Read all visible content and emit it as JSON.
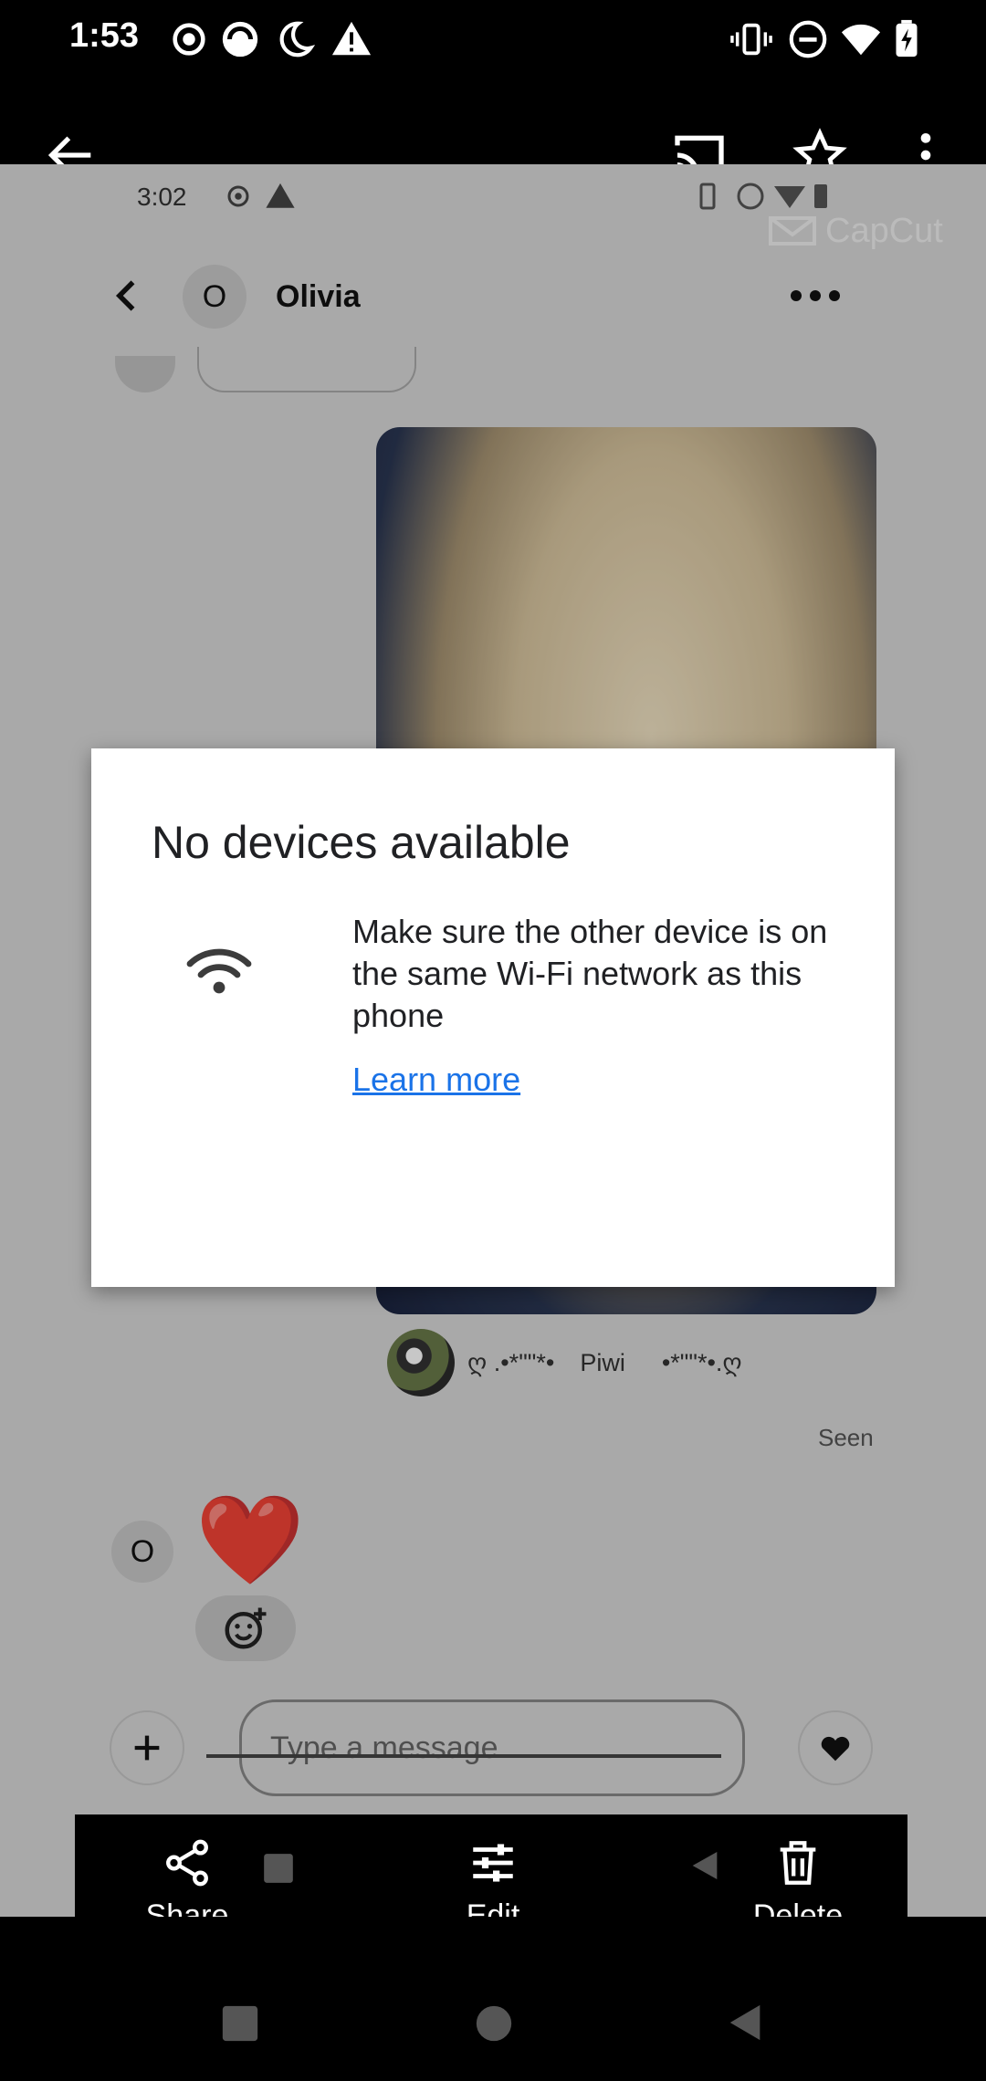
{
  "status_bar": {
    "time": "1:53"
  },
  "inner_status_bar": {
    "time": "3:02"
  },
  "watermark": "CapCut",
  "chat": {
    "contact_initial": "O",
    "contact_name": "Olivia",
    "caption": {
      "left_deco": "ღ .•*\"\"*•",
      "name": "Piwi",
      "right_deco": "•*\"\"*•.ღ"
    },
    "seen_label": "Seen",
    "heart_emoji": "❤️",
    "message_placeholder": "Type a message"
  },
  "dialog": {
    "title": "No devices available",
    "body": "Make sure the other device is on the same Wi-Fi network as this phone",
    "link": "Learn more"
  },
  "photo_toolbar": {
    "share": "Share",
    "edit": "Edit",
    "delete": "Delete"
  },
  "colors": {
    "link": "#1a73e8",
    "heart": "#e9452b",
    "dialog_bg": "#ffffff",
    "background": "#000000"
  }
}
